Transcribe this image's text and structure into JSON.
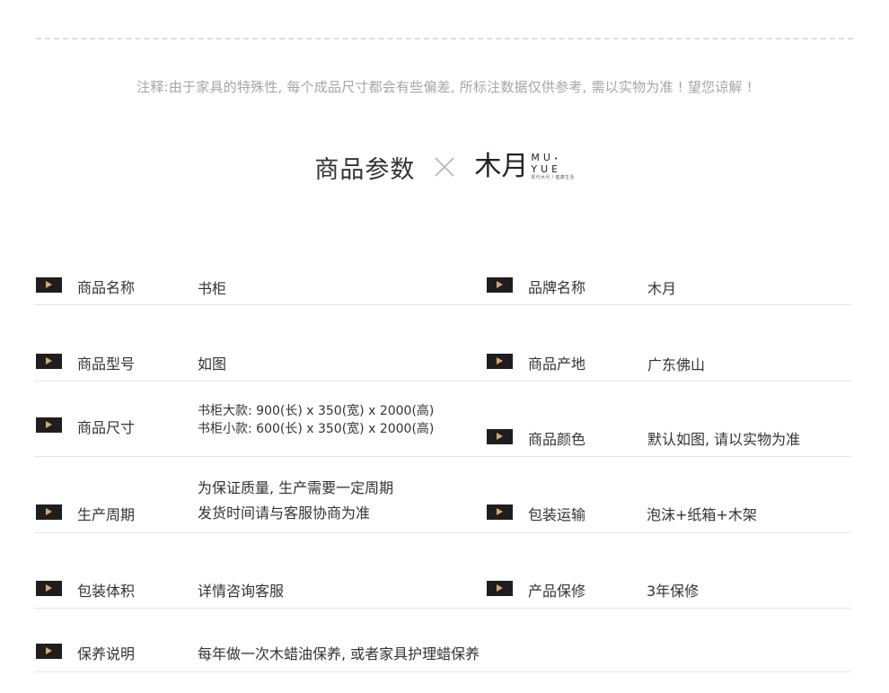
{
  "note": "注释:由于家具的特殊性, 每个成品尺寸都会有些偏差, 所标注数据仅供参考, 需以实物为准 ! 望您谅解 !",
  "title": "商品参数",
  "brand": {
    "mark": "木月",
    "word_top": "MU",
    "word_bottom": "YUE",
    "tagline": "现代木月 / 健康生活",
    "dot": "•"
  },
  "params": {
    "name": {
      "label": "商品名称",
      "value": "书柜"
    },
    "brand_name": {
      "label": "品牌名称",
      "value": "木月"
    },
    "model": {
      "label": "商品型号",
      "value": "如图"
    },
    "origin": {
      "label": "商品产地",
      "value": "广东佛山"
    },
    "size": {
      "label": "商品尺寸",
      "line1": "书柜大款: 900(长) x 350(宽) x 2000(高)",
      "line2": "书柜小款: 600(长) x 350(宽) x 2000(高)"
    },
    "color": {
      "label": "商品颜色",
      "value": "默认如图, 请以实物为准"
    },
    "cycle": {
      "label": "生产周期",
      "line1": "为保证质量, 生产需要一定周期",
      "line2": "发货时间请与客服协商为准"
    },
    "shipping": {
      "label": "包装运输",
      "value": "泡沫+纸箱+木架"
    },
    "volume": {
      "label": "包装体积",
      "value": "详情咨询客服"
    },
    "warranty": {
      "label": "产品保修",
      "value": "3年保修"
    },
    "care": {
      "label": "保养说明",
      "value": "每年做一次木蜡油保养, 或者家具护理蜡保养"
    }
  }
}
